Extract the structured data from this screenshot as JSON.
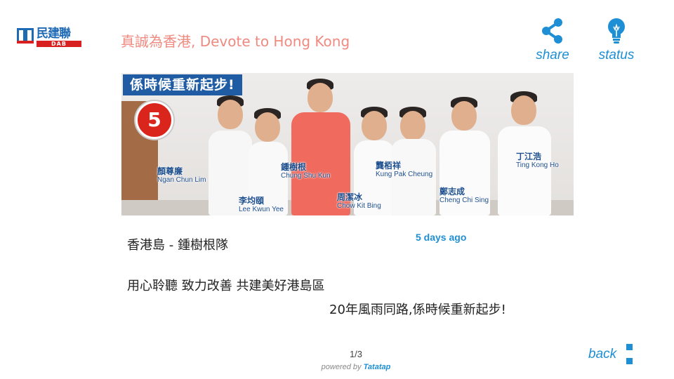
{
  "header": {
    "logo": {
      "name": "民建聯",
      "sub": "DAB"
    },
    "tagline": "真誠為香港, Devote to Hong Kong",
    "share_label": "share",
    "status_label": "status"
  },
  "banner": {
    "headline": "係時候重新起步!",
    "number": "5",
    "people": [
      {
        "zh": "顏尊廉",
        "en": "Ngan Chun Lim"
      },
      {
        "zh": "李均頤",
        "en": "Lee Kwun Yee"
      },
      {
        "zh": "鍾樹根",
        "en": "Chung Shu Kun"
      },
      {
        "zh": "周潔冰",
        "en": "Chow Kit Bing"
      },
      {
        "zh": "龔栢祥",
        "en": "Kung Pak Cheung"
      },
      {
        "zh": "鄭志成",
        "en": "Cheng Chi Sing"
      },
      {
        "zh": "丁江浩",
        "en": "Ting Kong Ho"
      }
    ]
  },
  "post": {
    "time": "5 days ago",
    "title": "香港島 - 鍾樹根隊",
    "line1": "用心聆聽 致力改善 共建美好港島區",
    "line2": "20年風雨同路,係時候重新起步!"
  },
  "footer": {
    "pager": "1/3",
    "powered_prefix": "powered by",
    "powered_brand": "Tatatap",
    "back_label": "back"
  },
  "colors": {
    "accent": "#1e8fd5",
    "tagline": "#f08a80",
    "brand_red": "#d9251c",
    "brand_blue": "#1f5ca3"
  }
}
